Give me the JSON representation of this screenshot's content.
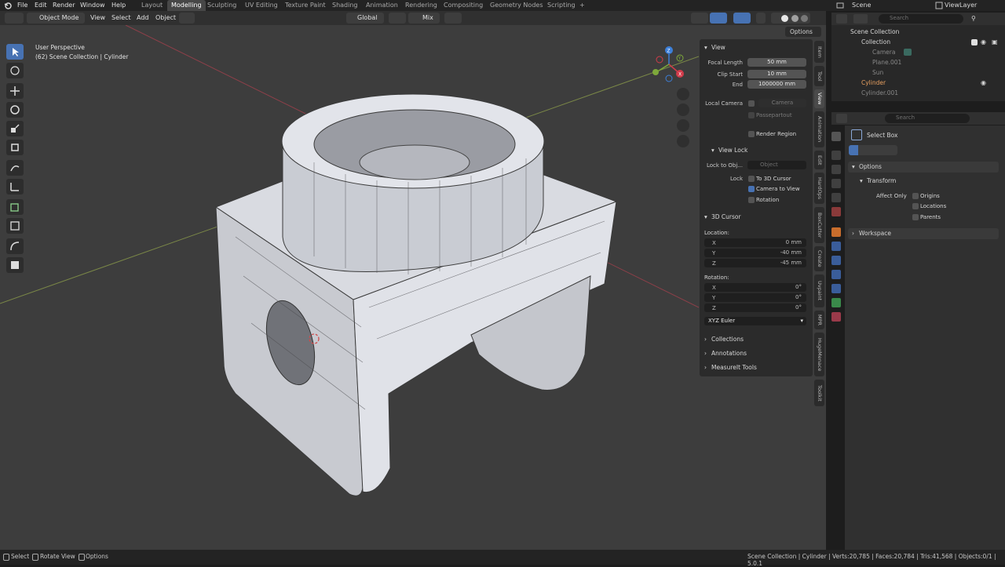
{
  "menus": [
    "File",
    "Edit",
    "Render",
    "Window",
    "Help"
  ],
  "workspaces": [
    {
      "label": "Layout"
    },
    {
      "label": "Modelling",
      "active": true
    },
    {
      "label": "Sculpting"
    },
    {
      "label": "UV Editing"
    },
    {
      "label": "Texture Paint"
    },
    {
      "label": "Shading"
    },
    {
      "label": "Animation"
    },
    {
      "label": "Rendering"
    },
    {
      "label": "Compositing"
    },
    {
      "label": "Geometry Nodes"
    },
    {
      "label": "Scripting"
    },
    {
      "label": "+"
    }
  ],
  "scene": {
    "name": "Scene",
    "view_layer": "ViewLayer"
  },
  "header": {
    "mode": "Object Mode",
    "view": "View",
    "select": "Select",
    "add": "Add",
    "object": "Object",
    "orientation": "Global",
    "pivot": "Mix",
    "options": "Options"
  },
  "viewport": {
    "perspective": "User Perspective",
    "context": "(62) Scene Collection | Cylinder"
  },
  "gizmo": {
    "y": "Y",
    "x": "X"
  },
  "npanel": {
    "view": {
      "title": "View",
      "focal_length_label": "Focal Length",
      "focal_length": "50 mm",
      "clip_start_label": "Clip Start",
      "clip_start": "10 mm",
      "end_label": "End",
      "end": "1000000 mm",
      "local_camera_label": "Local Camera",
      "local_camera": "Camera",
      "passepartout": "Passepartout",
      "render_region": "Render Region"
    },
    "view_lock": {
      "title": "View Lock",
      "lock_to_obj_label": "Lock to Obj...",
      "object_placeholder": "Object",
      "lock_label": "Lock",
      "to_3d_cursor": "To 3D Cursor",
      "camera_to_view": "Camera to View",
      "rotation": "Rotation"
    },
    "cursor": {
      "title": "3D Cursor",
      "location_label": "Location:",
      "loc_x_label": "X",
      "loc_x": "0 mm",
      "loc_y_label": "Y",
      "loc_y": "-40 mm",
      "loc_z_label": "Z",
      "loc_z": "-45 mm",
      "rotation_label": "Rotation:",
      "rot_x_label": "X",
      "rot_x": "0°",
      "rot_y_label": "Y",
      "rot_y": "0°",
      "rot_z_label": "Z",
      "rot_z": "0°",
      "rotation_mode": "XYZ Euler"
    },
    "collections": "Collections",
    "annotations": "Annotations",
    "measureit": "MeasureIt Tools"
  },
  "side_tabs": [
    "Item",
    "Tool",
    "View",
    "Animation",
    "Edit",
    "HardOps",
    "BoxCutter",
    "Create",
    "Uvpaint",
    "MPR",
    "HugeMenace",
    "Toolkit"
  ],
  "outliner": {
    "search_placeholder": "Search",
    "rows": [
      {
        "label": "Scene Collection",
        "indent": 0
      },
      {
        "label": "Collection",
        "indent": 1
      },
      {
        "label": "Camera",
        "indent": 2
      },
      {
        "label": "Plane.001",
        "indent": 2
      },
      {
        "label": "Sun",
        "indent": 2
      },
      {
        "label": "Cylinder",
        "indent": 1
      },
      {
        "label": "Cylinder.001",
        "indent": 1
      }
    ]
  },
  "properties": {
    "search_placeholder": "Search",
    "tool_name": "Select Box",
    "options": "Options",
    "transform": "Transform",
    "affect_only": "Affect Only",
    "origins": "Origins",
    "locations": "Locations",
    "parents": "Parents",
    "workspace": "Workspace"
  },
  "status": {
    "select": "Select",
    "rotate": "Rotate View",
    "options": "Options",
    "stats": "Scene Collection | Cylinder | Verts:20,785 | Faces:20,784 | Tris:41,568 | Objects:0/1 | 5.0.1"
  },
  "colors": {
    "accent": "#4772b3",
    "x_axis": "#d23b4a",
    "y_axis": "#7ea93b",
    "z_axis": "#3c7fd8"
  }
}
